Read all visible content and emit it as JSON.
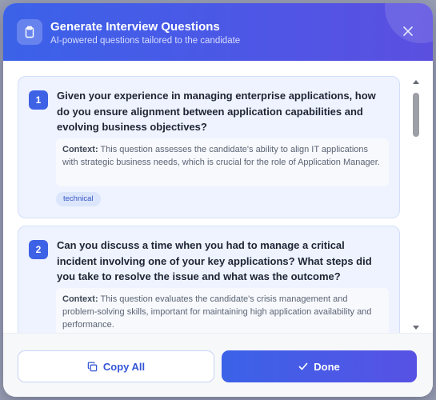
{
  "modal": {
    "title": "Generate Interview Questions",
    "subtitle": "AI-powered questions tailored to the candidate",
    "header_icon": "clipboard-icon",
    "close_icon": "close-icon"
  },
  "questions": [
    {
      "number": "1",
      "text": "Given your experience in managing enterprise applications, how do you ensure alignment between application capabilities and evolving business objectives?",
      "context_label": "Context:",
      "context": "This question assesses the candidate's ability to align IT applications with strategic business needs, which is crucial for the role of Application Manager.",
      "tag": "technical"
    },
    {
      "number": "2",
      "text": "Can you discuss a time when you had to manage a critical incident involving one of your key applications? What steps did you take to resolve the issue and what was the outcome?",
      "context_label": "Context:",
      "context": "This question evaluates the candidate's crisis management and problem-solving skills, important for maintaining high application availability and performance."
    }
  ],
  "footer": {
    "copy_all_label": "Copy All",
    "copy_icon": "copy-icon",
    "done_label": "Done",
    "done_icon": "check-icon"
  },
  "colors": {
    "accent": "#3d62e6",
    "accent_end": "#5752e4",
    "card_bg": "#eef3ff",
    "tag_bg": "#dbe5fb"
  }
}
